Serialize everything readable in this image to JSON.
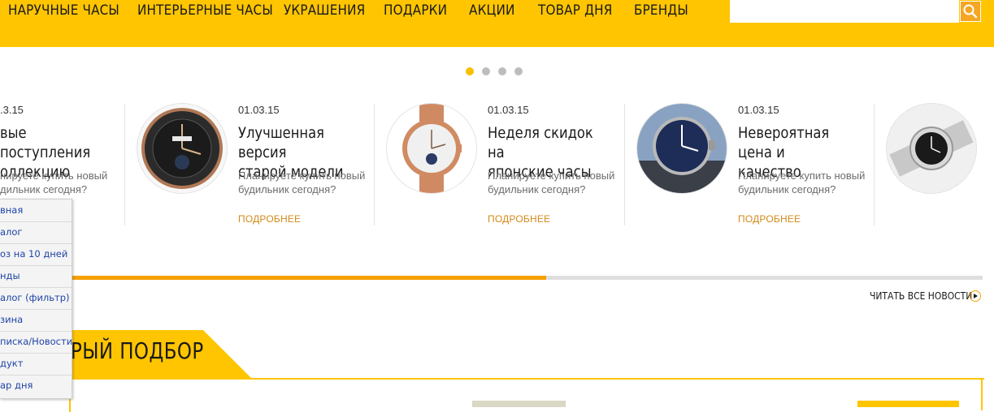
{
  "nav": {
    "items": [
      "НАРУЧНЫЕ ЧАСЫ",
      "ИНТЕРЬЕРНЫЕ ЧАСЫ",
      "УКРАШЕНИЯ",
      "ПОДАРКИ",
      "АКЦИИ",
      "ТОВАР ДНЯ",
      "БРЕНДЫ"
    ],
    "search_placeholder": "",
    "search_icon": "search-icon",
    "colors": {
      "bar": "#ffc500",
      "search_button": "#f5a623"
    }
  },
  "slider": {
    "dots": 4,
    "active_dot": 0,
    "colors": {
      "active": "#f7c000",
      "inactive": "#bdbdbd"
    }
  },
  "news": [
    {
      "date": ".3.15",
      "title_line1": "вые поступления",
      "title_line2": "оллекцию",
      "desc_line1": "нируете купить новый",
      "desc_line2": "дильник сегодня?",
      "more": ""
    },
    {
      "date": "01.03.15",
      "title_line1": "Улучшенная версия",
      "title_line2": "старой модели",
      "desc_line1": "Планируете купить новый",
      "desc_line2": "будильник сегодня?",
      "more": "ПОДРОБНЕЕ"
    },
    {
      "date": "01.03.15",
      "title_line1": "Неделя скидок на",
      "title_line2": "японские часы",
      "desc_line1": "Планируете купить новый",
      "desc_line2": "будильник сегодня?",
      "more": "ПОДРОБНЕЕ"
    },
    {
      "date": "01.03.15",
      "title_line1": "Невероятная цена и",
      "title_line2": "качество",
      "desc_line1": "Планируете купить новый",
      "desc_line2": "будильник сегодня?",
      "more": "ПОДРОБНЕЕ"
    }
  ],
  "progress": {
    "fraction": 0.556,
    "color": "#f5a000"
  },
  "read_all": "ЧИТАТЬ ВСЕ НОВОСТИ",
  "section": {
    "title": "РЫЙ ПОДБОР"
  },
  "menu": [
    "вная",
    "алог",
    "оз на 10 дней",
    "нды",
    "алог (фильтр)",
    "зина",
    "писка/Новости",
    "дукт",
    "ар дня"
  ]
}
